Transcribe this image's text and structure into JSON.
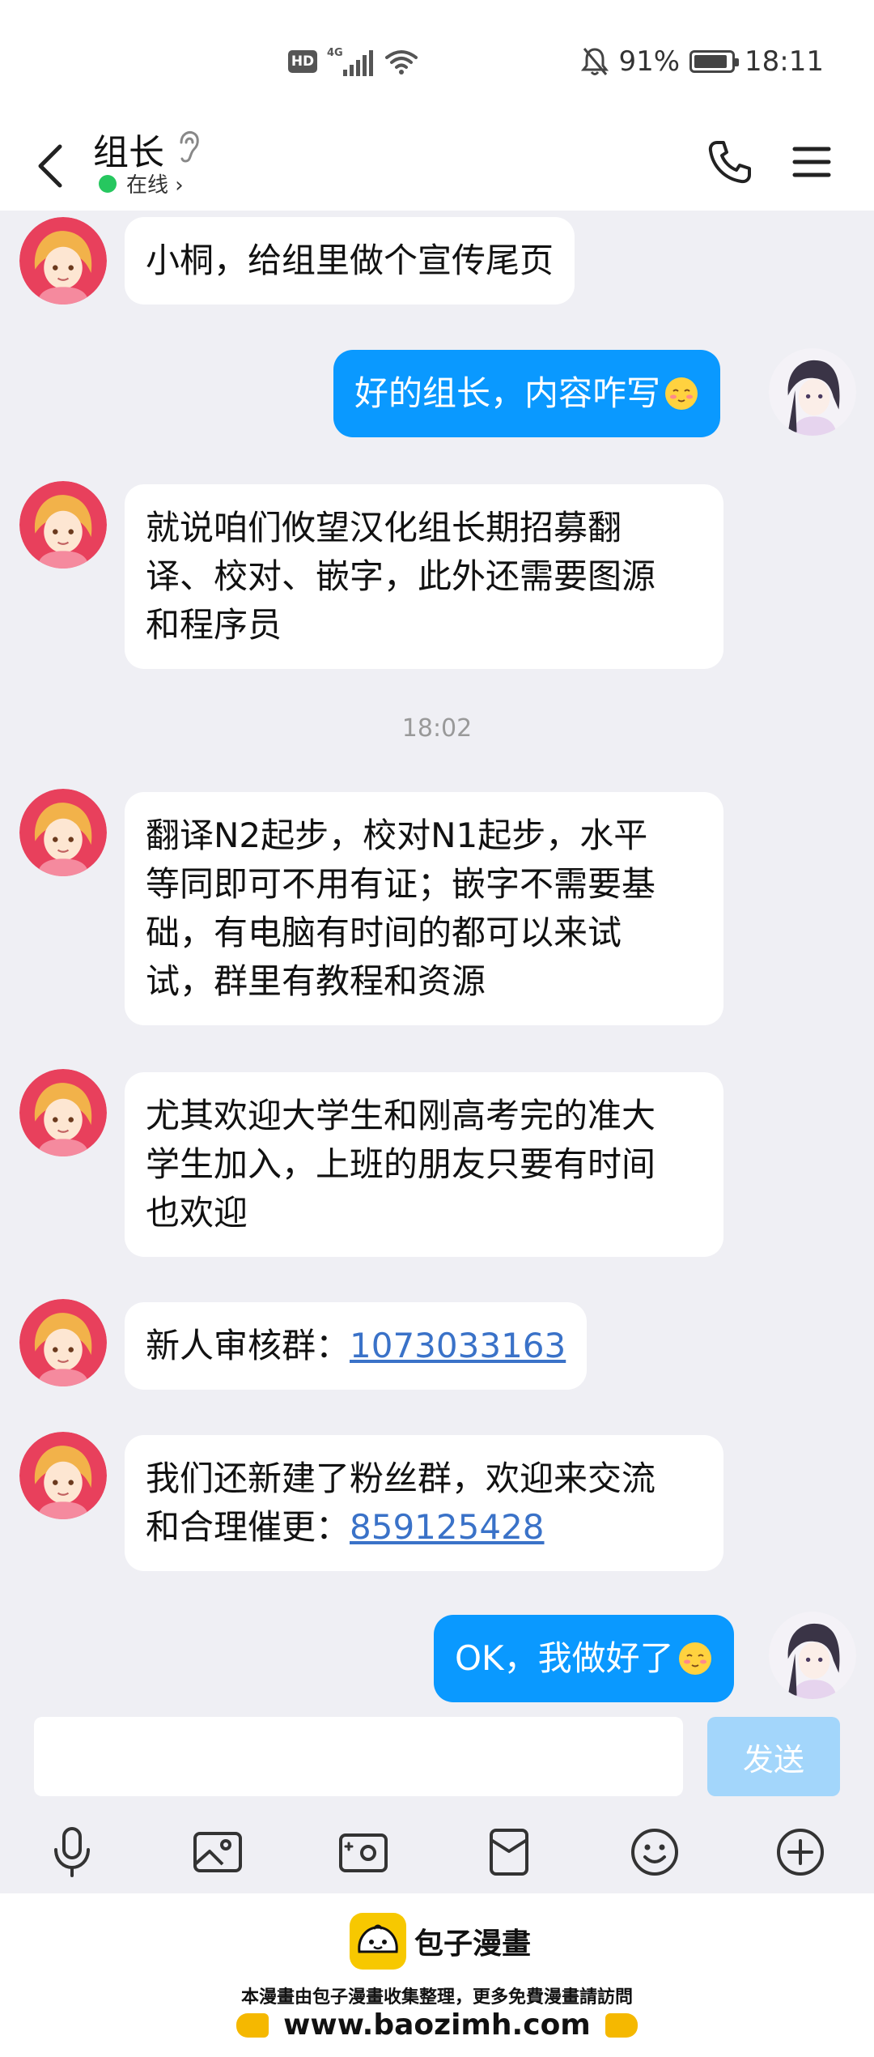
{
  "status_bar": {
    "hd_badge": "HD",
    "network": "4G",
    "battery_percent": "91%",
    "battery_level": 0.91,
    "time": "18:11"
  },
  "header": {
    "contact_name": "组长",
    "online_status": "在线 ›",
    "back_icon": "back-arrow-icon",
    "phone_icon": "phone-icon",
    "menu_icon": "menu-icon"
  },
  "messages": [
    {
      "side": "in",
      "text": "小桐，给组里做个宣传尾页"
    },
    {
      "side": "out",
      "text": "好的组长，内容咋写"
    },
    {
      "side": "in",
      "text_lines": [
        "就说咱们攸望汉化组长期招募翻",
        "译、校对、嵌字，此外还需要图源",
        "和程序员"
      ]
    },
    {
      "side": "in",
      "text_lines": [
        "翻译N2起步，校对N1起步，水平",
        "等同即可不用有证；嵌字不需要基",
        "础，有电脑有时间的都可以来试",
        "试，群里有教程和资源"
      ]
    },
    {
      "side": "in",
      "text_lines": [
        "尤其欢迎大学生和刚高考完的准大",
        "学生加入，上班的朋友只要有时间",
        "也欢迎"
      ]
    },
    {
      "side": "in",
      "prefix": "新人审核群：",
      "link": "1073033163"
    },
    {
      "side": "in",
      "text_lines": [
        "我们还新建了粉丝群，欢迎来交流"
      ],
      "prefix": "和合理催更：",
      "link": "859125428"
    },
    {
      "side": "out",
      "text": "OK，我做好了"
    }
  ],
  "time_separator": "18:02",
  "input": {
    "placeholder": "",
    "send_label": "发送"
  },
  "toolbar": [
    "mic-icon",
    "image-icon",
    "camera-icon",
    "red-packet-icon",
    "emoji-icon",
    "plus-icon"
  ],
  "footer": {
    "brand_name": "包子漫畫",
    "note": "本漫畫由包子漫畫收集整理，更多免費漫畫請訪問",
    "url": "www.baozimh.com"
  },
  "colors": {
    "outgoing_bubble": "#0a99ff",
    "incoming_bubble": "#ffffff",
    "chat_background": "#efeff4",
    "link": "#3a72c8",
    "online_dot": "#26c75f",
    "send_button": "#a3d6fb"
  }
}
